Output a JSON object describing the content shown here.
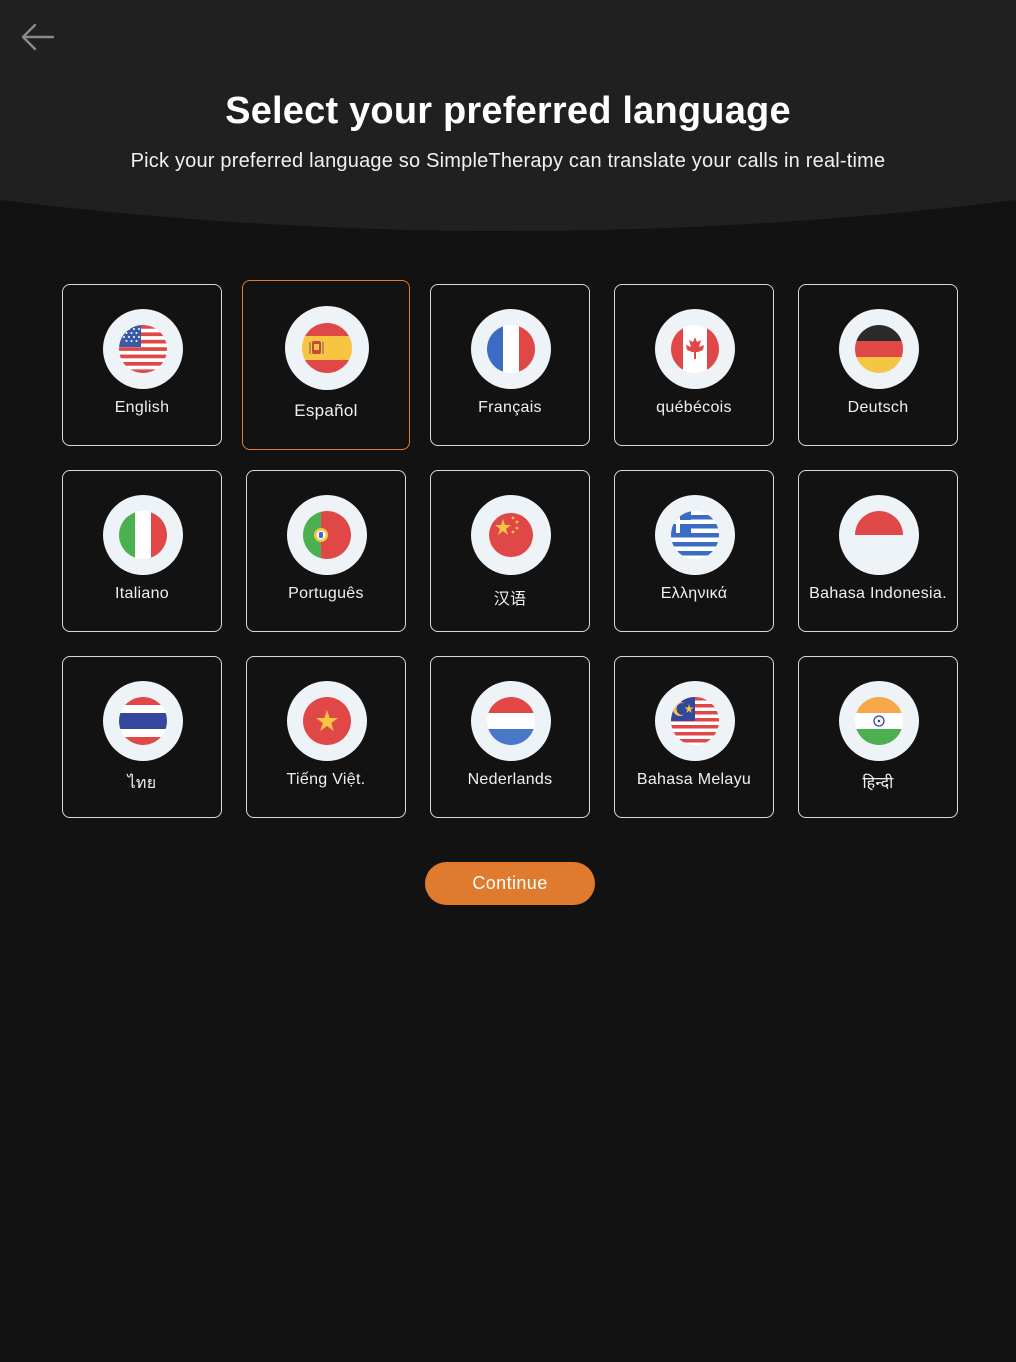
{
  "header": {
    "title": "Select your preferred language",
    "subtitle": "Pick your preferred language so SimpleTherapy can translate your calls in real-time",
    "back_icon": "arrow-left-icon"
  },
  "languages": [
    {
      "label": "English",
      "flag": "us-flag-icon",
      "selected": false
    },
    {
      "label": "Español",
      "flag": "spain-flag-icon",
      "selected": true
    },
    {
      "label": "Français",
      "flag": "france-flag-icon",
      "selected": false
    },
    {
      "label": "québécois",
      "flag": "canada-flag-icon",
      "selected": false
    },
    {
      "label": "Deutsch",
      "flag": "germany-flag-icon",
      "selected": false
    },
    {
      "label": "Italiano",
      "flag": "italy-flag-icon",
      "selected": false
    },
    {
      "label": "Português",
      "flag": "portugal-flag-icon",
      "selected": false
    },
    {
      "label": "汉语",
      "flag": "china-flag-icon",
      "selected": false
    },
    {
      "label": "Ελληνικά",
      "flag": "greece-flag-icon",
      "selected": false
    },
    {
      "label": "Bahasa Indonesia.",
      "flag": "indonesia-flag-icon",
      "selected": false
    },
    {
      "label": "ไทย",
      "flag": "thailand-flag-icon",
      "selected": false
    },
    {
      "label": "Tiếng Việt.",
      "flag": "vietnam-flag-icon",
      "selected": false
    },
    {
      "label": "Nederlands",
      "flag": "netherlands-flag-icon",
      "selected": false
    },
    {
      "label": "Bahasa Melayu",
      "flag": "malaysia-flag-icon",
      "selected": false
    },
    {
      "label": "हिन्दी",
      "flag": "india-flag-icon",
      "selected": false
    }
  ],
  "continue_label": "Continue",
  "colors": {
    "accent": "#e07a2e",
    "background": "#121212",
    "header_bg": "#1f1f1f"
  }
}
